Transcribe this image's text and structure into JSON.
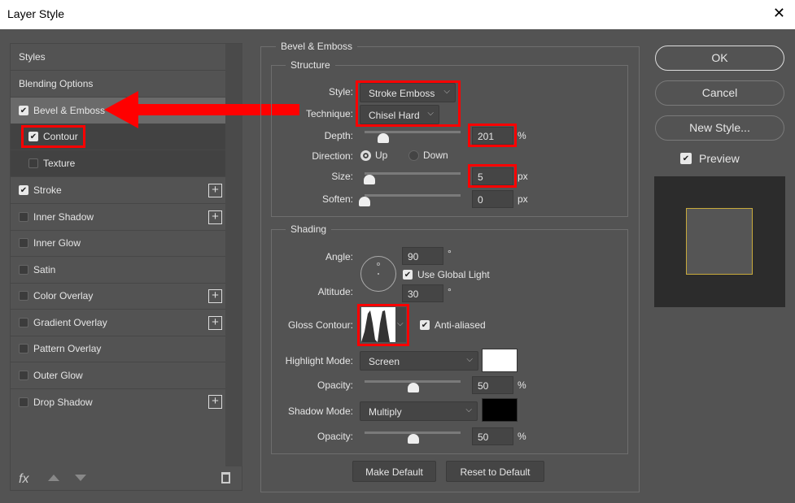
{
  "window": {
    "title": "Layer Style",
    "close": "✕"
  },
  "sidebar": {
    "items": [
      {
        "label": "Styles"
      },
      {
        "label": "Blending Options"
      },
      {
        "label": "Bevel & Emboss",
        "checked": true
      },
      {
        "label": "Contour",
        "checked": true
      },
      {
        "label": "Texture",
        "checked": false
      },
      {
        "label": "Stroke",
        "checked": true
      },
      {
        "label": "Inner Shadow",
        "checked": false
      },
      {
        "label": "Inner Glow",
        "checked": false
      },
      {
        "label": "Satin",
        "checked": false
      },
      {
        "label": "Color Overlay",
        "checked": false
      },
      {
        "label": "Gradient Overlay",
        "checked": false
      },
      {
        "label": "Pattern Overlay",
        "checked": false
      },
      {
        "label": "Outer Glow",
        "checked": false
      },
      {
        "label": "Drop Shadow",
        "checked": false
      }
    ],
    "fx": "fx",
    "plus": "+",
    "check": "✔"
  },
  "bevel": {
    "title": "Bevel & Emboss",
    "structure": {
      "title": "Structure",
      "style_label": "Style:",
      "style": "Stroke Emboss",
      "technique_label": "Technique:",
      "technique": "Chisel Hard",
      "depth_label": "Depth:",
      "depth": "201",
      "depth_unit": "%",
      "direction_label": "Direction:",
      "up": "Up",
      "down": "Down",
      "size_label": "Size:",
      "size": "5",
      "size_unit": "px",
      "soften_label": "Soften:",
      "soften": "0",
      "soften_unit": "px"
    },
    "shading": {
      "title": "Shading",
      "angle_label": "Angle:",
      "angle": "90",
      "deg": "°",
      "global_light": "Use Global Light",
      "altitude_label": "Altitude:",
      "altitude": "30",
      "gloss_label": "Gloss Contour:",
      "anti_aliased": "Anti-aliased",
      "highlight_label": "Highlight Mode:",
      "highlight_mode": "Screen",
      "highlight_color": "#ffffff",
      "opacity_label": "Opacity:",
      "highlight_opacity": "50",
      "pct": "%",
      "shadow_label": "Shadow Mode:",
      "shadow_mode": "Multiply",
      "shadow_color": "#000000",
      "shadow_opacity": "50"
    },
    "make_default": "Make Default",
    "reset_default": "Reset to Default"
  },
  "buttons": {
    "ok": "OK",
    "cancel": "Cancel",
    "new_style": "New Style...",
    "preview": "Preview"
  },
  "chev": "⌵"
}
